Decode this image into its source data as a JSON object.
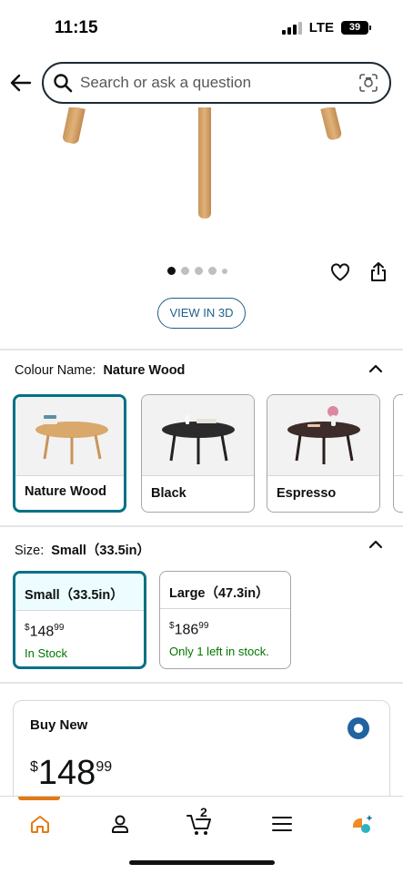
{
  "status_bar": {
    "time": "11:15",
    "network": "LTE",
    "battery": "39"
  },
  "search": {
    "placeholder": "Search or ask a question"
  },
  "product": {
    "image_dots": 5,
    "view_3d_label": "VIEW IN 3D"
  },
  "colour": {
    "label": "Colour Name:",
    "selected": "Nature Wood",
    "options": [
      {
        "name": "Nature Wood",
        "selected": true
      },
      {
        "name": "Black",
        "selected": false
      },
      {
        "name": "Espresso",
        "selected": false
      }
    ]
  },
  "size": {
    "label": "Size:",
    "selected": "Small（33.5in）",
    "options": [
      {
        "name": "Small（33.5in）",
        "price_currency": "$",
        "price_whole": "148",
        "price_fraction": "99",
        "stock": "In Stock",
        "selected": true
      },
      {
        "name": "Large（47.3in）",
        "price_currency": "$",
        "price_whole": "186",
        "price_fraction": "99",
        "stock": "Only 1 left in stock.",
        "selected": false
      }
    ]
  },
  "buy_new": {
    "title": "Buy New",
    "price_currency": "$",
    "price_whole": "148",
    "price_fraction": "99"
  },
  "tabbar": {
    "cart_count": "2",
    "tabs": [
      "home-icon",
      "account-icon",
      "cart-icon",
      "menu-icon",
      "rufus-icon"
    ]
  },
  "colors": {
    "accent_teal": "#007185",
    "link_blue": "#1f5f8a",
    "in_stock_green": "#007600",
    "tab_active_orange": "#e47911"
  }
}
